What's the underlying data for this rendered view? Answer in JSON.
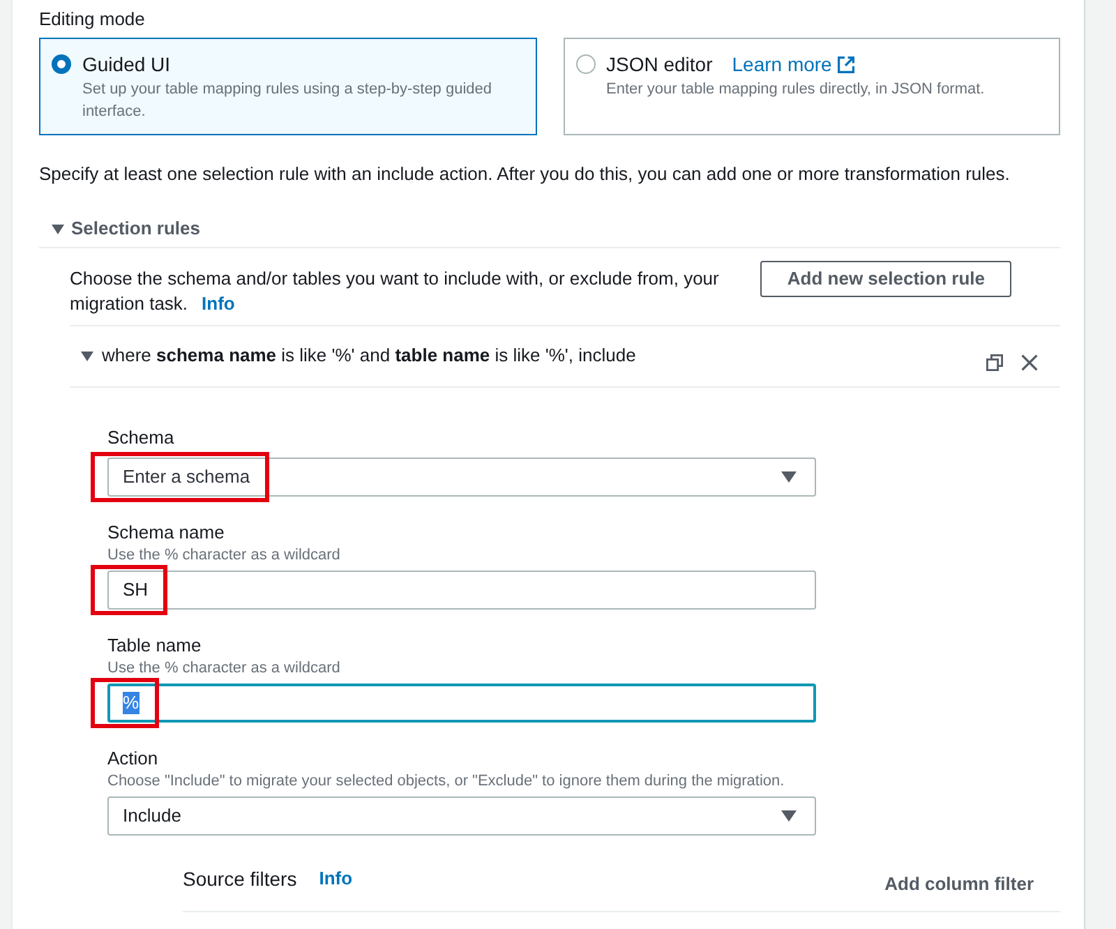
{
  "editing_mode": {
    "label": "Editing mode",
    "options": [
      {
        "title": "Guided UI",
        "description": "Set up your table mapping rules using a step-by-step guided interface.",
        "selected": true
      },
      {
        "title": "JSON editor",
        "link": "Learn more",
        "description": "Enter your table mapping rules directly, in JSON format.",
        "selected": false
      }
    ]
  },
  "instruction": "Specify at least one selection rule with an include action. After you do this, you can add one or more transformation rules.",
  "selection_rules": {
    "title": "Selection rules",
    "expanded": true,
    "description": "Choose the schema and/or tables you want to include with, or exclude from, your migration task.",
    "info": "Info",
    "add_button": "Add new selection rule",
    "rule": {
      "summary": "where **schema name** is like '%' and **table name** is like '%', include",
      "expanded": true,
      "fields": [
        {
          "kind": "select",
          "label": "Schema",
          "placeholder": "Enter a schema",
          "highlighted": true,
          "focused": false,
          "text_selected": false
        },
        {
          "kind": "text",
          "label": "Schema name",
          "hint": "Use the % character as a wildcard",
          "value": "SH",
          "highlighted": true,
          "focused": false,
          "text_selected": false
        },
        {
          "kind": "text",
          "label": "Table name",
          "hint": "Use the % character as a wildcard",
          "value": "%",
          "highlighted": true,
          "focused": true,
          "text_selected": true
        },
        {
          "kind": "select",
          "label": "Action",
          "hint": "Choose \"Include\" to migrate your selected objects, or \"Exclude\" to ignore them during the migration.",
          "value": "Include",
          "highlighted": false,
          "focused": false,
          "text_selected": false
        }
      ],
      "source_filters": {
        "title": "Source filters",
        "info": "Info",
        "add_button": "Add column filter"
      }
    }
  }
}
